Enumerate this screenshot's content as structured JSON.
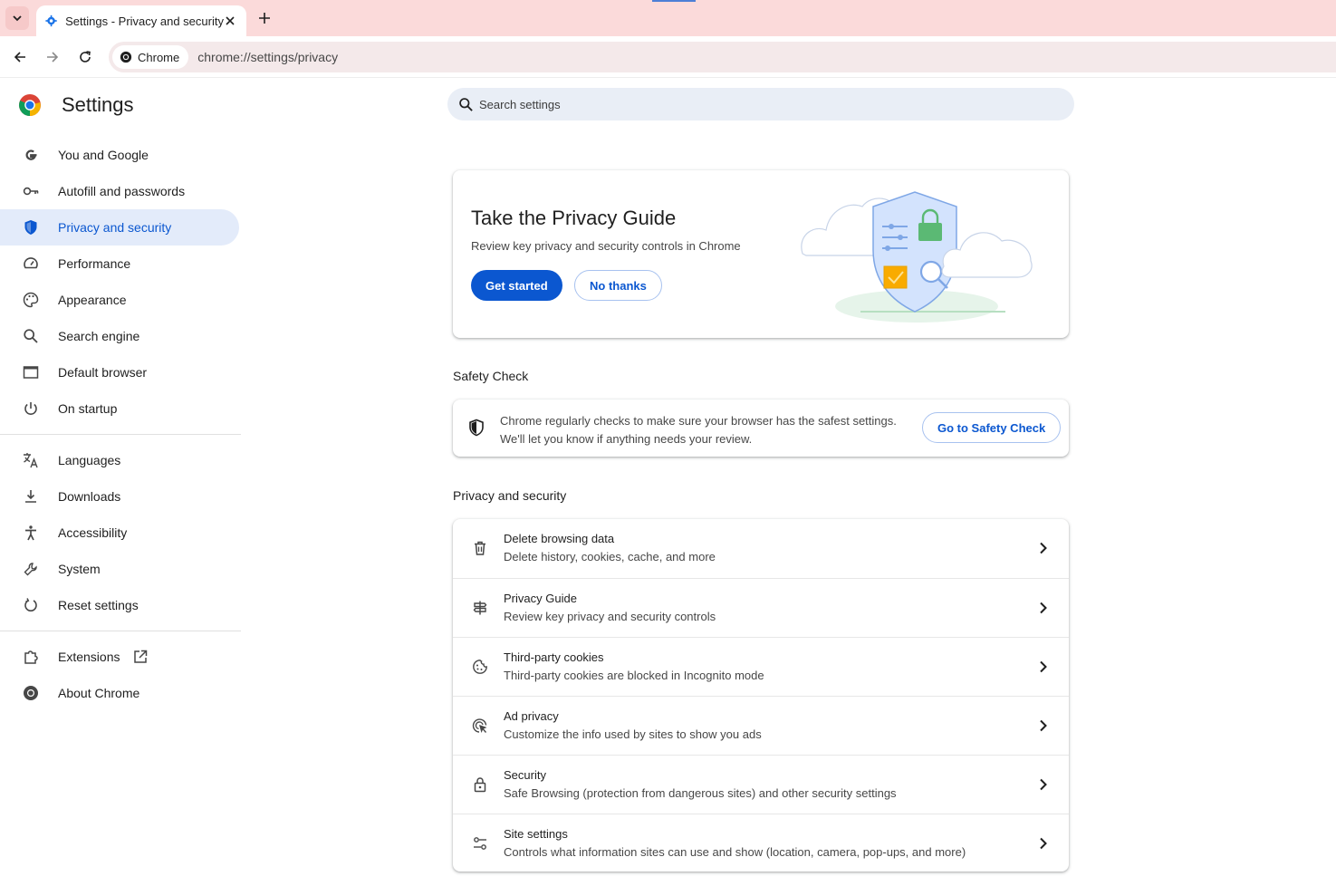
{
  "browser": {
    "tab_title": "Settings - Privacy and security",
    "chip_label": "Chrome",
    "url": "chrome://settings/privacy"
  },
  "sidebar": {
    "title": "Settings",
    "items": [
      {
        "label": "You and Google",
        "icon": "google-g-icon"
      },
      {
        "label": "Autofill and passwords",
        "icon": "key-icon"
      },
      {
        "label": "Privacy and security",
        "icon": "shield-icon",
        "active": true
      },
      {
        "label": "Performance",
        "icon": "speedometer-icon"
      },
      {
        "label": "Appearance",
        "icon": "palette-icon"
      },
      {
        "label": "Search engine",
        "icon": "search-icon"
      },
      {
        "label": "Default browser",
        "icon": "browser-window-icon"
      },
      {
        "label": "On startup",
        "icon": "power-icon"
      },
      {
        "label": "Languages",
        "icon": "translate-icon"
      },
      {
        "label": "Downloads",
        "icon": "download-icon"
      },
      {
        "label": "Accessibility",
        "icon": "accessibility-icon"
      },
      {
        "label": "System",
        "icon": "wrench-icon"
      },
      {
        "label": "Reset settings",
        "icon": "reset-icon"
      },
      {
        "label": "Extensions",
        "icon": "puzzle-icon"
      },
      {
        "label": "About Chrome",
        "icon": "chrome-icon"
      }
    ]
  },
  "search": {
    "placeholder": "Search settings"
  },
  "privacy_guide": {
    "title": "Take the Privacy Guide",
    "description": "Review key privacy and security controls in Chrome",
    "get_started": "Get started",
    "no_thanks": "No thanks"
  },
  "safety_check": {
    "section_title": "Safety Check",
    "line1": "Chrome regularly checks to make sure your browser has the safest settings.",
    "line2": "We'll let you know if anything needs your review.",
    "button": "Go to Safety Check"
  },
  "privacy_section": {
    "section_title": "Privacy and security",
    "rows": [
      {
        "title": "Delete browsing data",
        "subtitle": "Delete history, cookies, cache, and more",
        "icon": "trash-icon"
      },
      {
        "title": "Privacy Guide",
        "subtitle": "Review key privacy and security controls",
        "icon": "signpost-icon"
      },
      {
        "title": "Third-party cookies",
        "subtitle": "Third-party cookies are blocked in Incognito mode",
        "icon": "cookie-icon"
      },
      {
        "title": "Ad privacy",
        "subtitle": "Customize the info used by sites to show you ads",
        "icon": "ad-privacy-icon"
      },
      {
        "title": "Security",
        "subtitle": "Safe Browsing (protection from dangerous sites) and other security settings",
        "icon": "lock-icon"
      },
      {
        "title": "Site settings",
        "subtitle": "Controls what information sites can use and show (location, camera, pop-ups, and more)",
        "icon": "sliders-icon"
      }
    ]
  },
  "colors": {
    "accent": "#0b57d0",
    "tabstrip": "#fbdada",
    "active_nav": "#e3ebfa"
  }
}
